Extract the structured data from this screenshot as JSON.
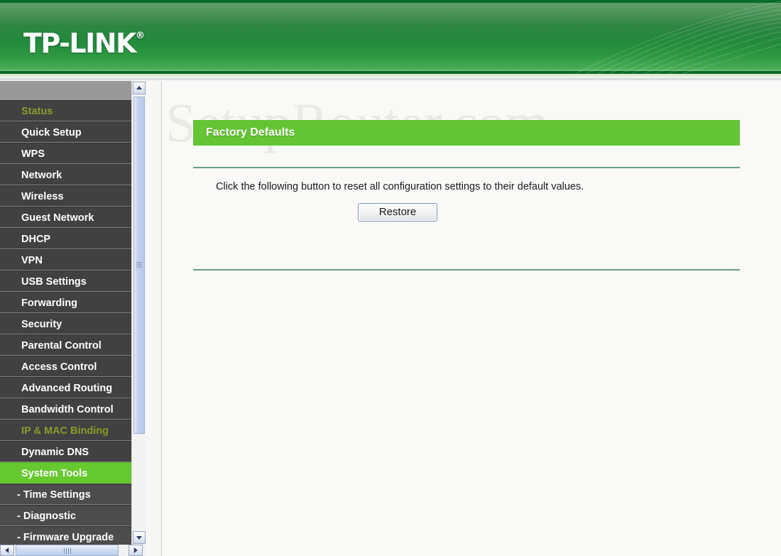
{
  "header": {
    "brand": "TP-LINK",
    "brand_mark": "®",
    "background_color": "#2e8542"
  },
  "sidebar": {
    "items": [
      {
        "label": "Status",
        "state": "visited",
        "level": "top"
      },
      {
        "label": "Quick Setup",
        "state": "normal",
        "level": "top"
      },
      {
        "label": "WPS",
        "state": "normal",
        "level": "top"
      },
      {
        "label": "Network",
        "state": "normal",
        "level": "top"
      },
      {
        "label": "Wireless",
        "state": "normal",
        "level": "top"
      },
      {
        "label": "Guest Network",
        "state": "normal",
        "level": "top"
      },
      {
        "label": "DHCP",
        "state": "normal",
        "level": "top"
      },
      {
        "label": "VPN",
        "state": "normal",
        "level": "top"
      },
      {
        "label": "USB Settings",
        "state": "normal",
        "level": "top"
      },
      {
        "label": "Forwarding",
        "state": "normal",
        "level": "top"
      },
      {
        "label": "Security",
        "state": "normal",
        "level": "top"
      },
      {
        "label": "Parental Control",
        "state": "normal",
        "level": "top"
      },
      {
        "label": "Access Control",
        "state": "normal",
        "level": "top"
      },
      {
        "label": "Advanced Routing",
        "state": "normal",
        "level": "top"
      },
      {
        "label": "Bandwidth Control",
        "state": "normal",
        "level": "top"
      },
      {
        "label": "IP & MAC Binding",
        "state": "visited",
        "level": "top"
      },
      {
        "label": "Dynamic DNS",
        "state": "normal",
        "level": "top"
      },
      {
        "label": "System Tools",
        "state": "active",
        "level": "top"
      },
      {
        "label": "- Time Settings",
        "state": "normal",
        "level": "sub"
      },
      {
        "label": "- Diagnostic",
        "state": "normal",
        "level": "sub"
      },
      {
        "label": "- Firmware Upgrade",
        "state": "normal",
        "level": "sub"
      }
    ],
    "active_color": "#65c92f",
    "visited_color": "#8c9a2b",
    "background_color": "#414141",
    "scrollbar": {
      "up_icon": "chevron-up-icon",
      "down_icon": "chevron-down-icon",
      "left_icon": "chevron-left-icon",
      "right_icon": "chevron-right-icon"
    }
  },
  "content": {
    "watermark": "SetupRouter.com",
    "panel_title": "Factory Defaults",
    "panel_title_color": "#63c434",
    "description": "Click the following button to reset all configuration settings to their default values.",
    "restore_label": "Restore"
  }
}
